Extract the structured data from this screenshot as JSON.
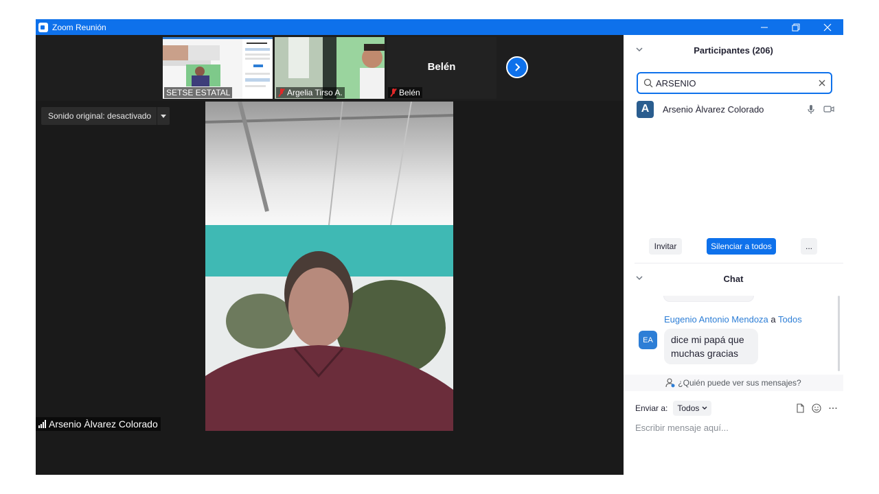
{
  "window": {
    "title": "Zoom Reunión"
  },
  "thumbnails": [
    {
      "name": "SETSE ESTATAL",
      "muted": false
    },
    {
      "name": "Argelia Tirso A.",
      "muted": true
    },
    {
      "name": "Belén",
      "muted": true,
      "label": "Belén"
    }
  ],
  "video": {
    "original_sound": "Sonido original: desactivado",
    "speaker": "Arsenio Àlvarez Colorado"
  },
  "participants": {
    "title": "Participantes (206)",
    "search_value": "ARSENIO",
    "list": [
      {
        "initial": "A",
        "name": "Arsenio Àlvarez Colorado"
      }
    ],
    "invite_label": "Invitar",
    "mute_all_label": "Silenciar a todos",
    "more_label": "..."
  },
  "chat": {
    "title": "Chat",
    "message": {
      "sender": "Eugenio Antonio Mendoza",
      "to_word": "a",
      "recipient": "Todos",
      "initials": "EA",
      "text": "dice mi papá que muchas gracias"
    },
    "who_sees": "¿Quién puede ver sus mensajes?",
    "send_to_label": "Enviar a:",
    "send_to_value": "Todos",
    "placeholder": "Escribir mensaje aquí..."
  },
  "colors": {
    "accent": "#0e71eb",
    "muted": "#e02828",
    "link": "#2d7ed6"
  }
}
